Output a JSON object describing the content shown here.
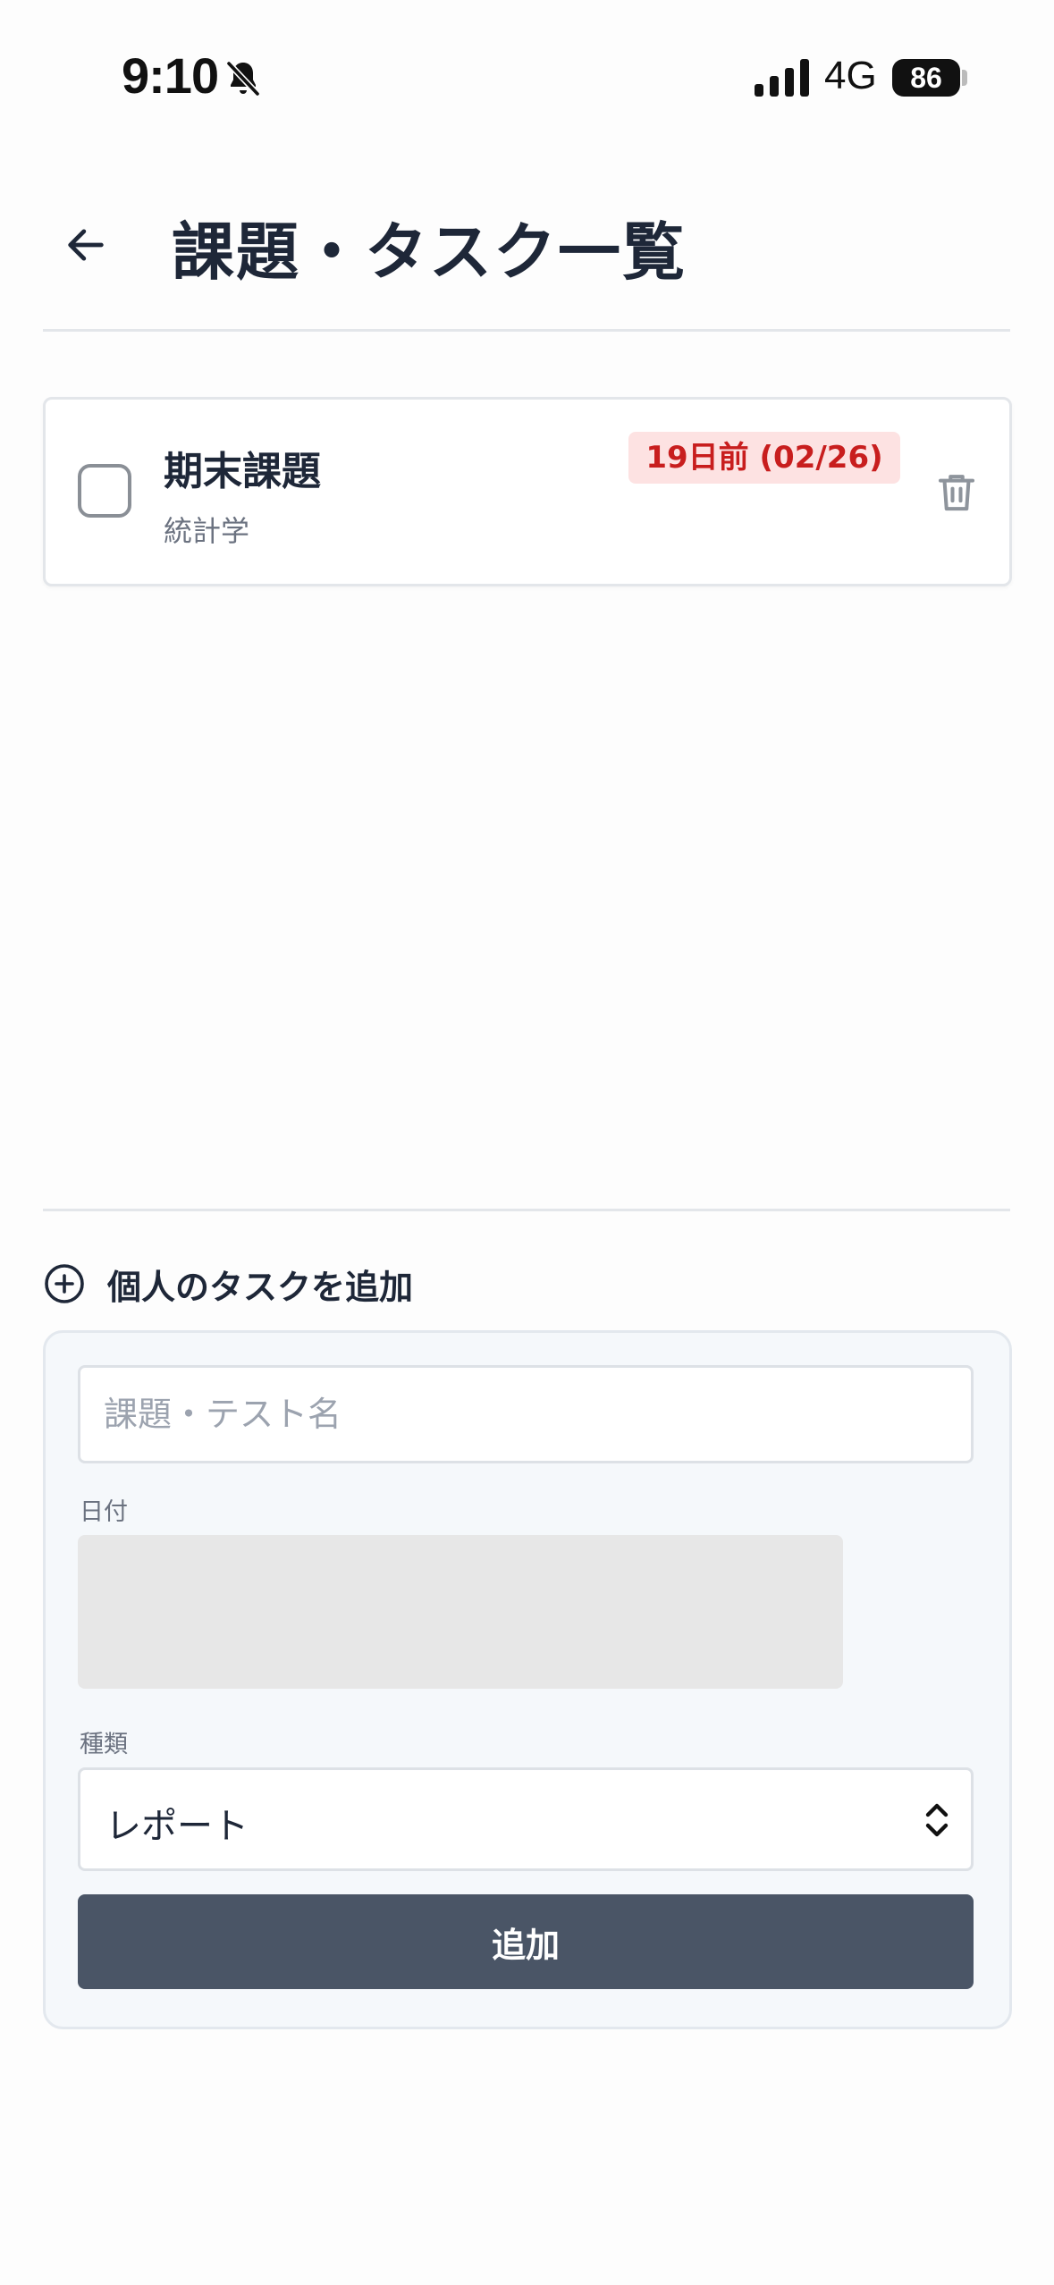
{
  "status_bar": {
    "time": "9:10",
    "network": "4G",
    "battery": "86"
  },
  "header": {
    "title": "課題・タスク一覧"
  },
  "tasks": [
    {
      "title": "期末課題",
      "subject": "統計学",
      "due_badge": "19日前 (02/26)",
      "checked": false
    }
  ],
  "add_section": {
    "label": "個人のタスクを追加",
    "name_placeholder": "課題・テスト名",
    "date_label": "日付",
    "type_label": "種類",
    "type_value": "レポート",
    "submit_label": "追加"
  },
  "colors": {
    "badge_bg": "#fde2e2",
    "badge_text": "#c81e1e",
    "button_bg": "#4a5566",
    "title_text": "#1e2738"
  }
}
